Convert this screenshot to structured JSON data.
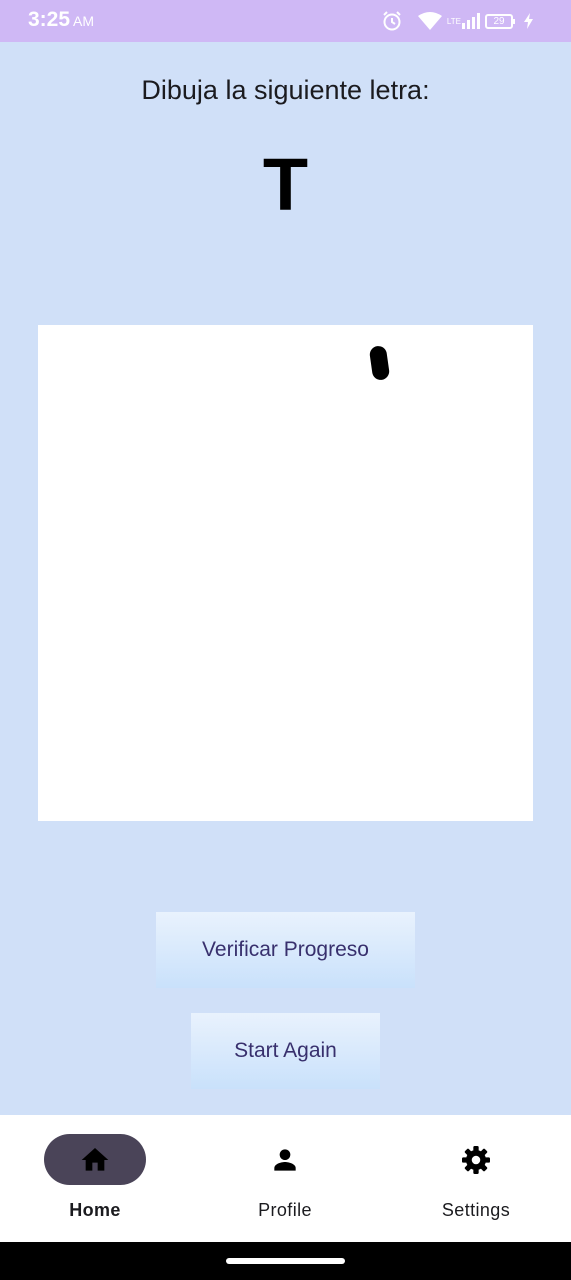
{
  "status_bar": {
    "time": "3:25",
    "ampm": "AM",
    "network": "LTE",
    "battery": "29",
    "icons": [
      "alarm-icon",
      "wifi-icon",
      "signal-icon",
      "battery-icon",
      "charging-icon"
    ]
  },
  "main": {
    "prompt": "Dibuja la siguiente letra:",
    "letter": "T"
  },
  "buttons": {
    "verify_label": "Verificar Progreso",
    "again_label": "Start Again"
  },
  "nav": {
    "items": [
      {
        "label": "Home",
        "icon": "home-icon",
        "selected": true
      },
      {
        "label": "Profile",
        "icon": "person-icon",
        "selected": false
      },
      {
        "label": "Settings",
        "icon": "gear-icon",
        "selected": false
      }
    ]
  },
  "colors": {
    "status_bar": "#cfb8f5",
    "background": "#d0e0f8",
    "button_text": "#38306d",
    "nav_pill": "#4a4458"
  }
}
